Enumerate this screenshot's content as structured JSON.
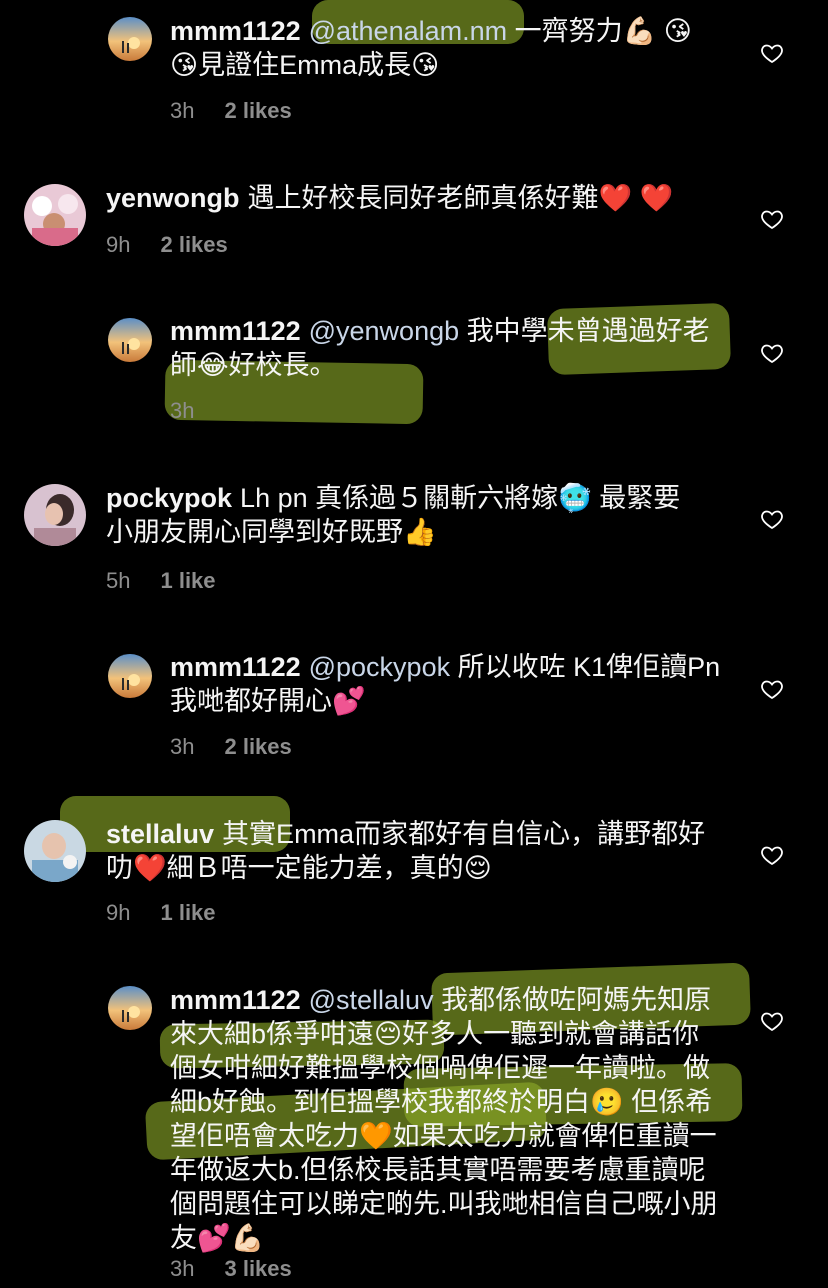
{
  "comments": [
    {
      "user": "mmm1122",
      "mention": "@athenalam.nm",
      "text": "一齊努力💪🏻 😘 😘見證住Emma成長😘",
      "time": "3h",
      "likes": "2 likes"
    },
    {
      "user": "yenwongb",
      "text": "遇上好校長同好老師真係好難❤️ ❤️",
      "time": "9h",
      "likes": "2 likes"
    },
    {
      "user": "mmm1122",
      "mention": "@yenwongb",
      "text": "我中學未曾遇過好老師😂好校長。",
      "time": "3h",
      "likes": ""
    },
    {
      "user": "pockypok",
      "text": "Lh pn 真係過５關斬六將嫁🥶 最緊要小朋友開心同學到好既野👍",
      "time": "5h",
      "likes": "1 like"
    },
    {
      "user": "mmm1122",
      "mention": "@pockypok",
      "text": "所以收咗 K1俾佢讀Pn 我哋都好開心💕",
      "time": "3h",
      "likes": "2 likes"
    },
    {
      "user": "stellaluv",
      "text": "其實Emma而家都好有自信心，講野都好叻❤️細Ｂ唔一定能力差，真的😌",
      "time": "9h",
      "likes": "1 like"
    },
    {
      "user": "mmm1122",
      "mention": "@stellaluv",
      "text": "我都係做咗阿媽先知原來大細b係爭咁遠😔好多人一聽到就會講話你個女咁細好難搵學校個喎俾佢遲一年讀啦。做細b好蝕。到佢搵學校我都終於明白🥲 但係希望佢唔會太吃力🧡如果太吃力就會俾佢重讀一年做返大b.但係校長話其實唔需要考慮重讀呢個問題住可以睇定啲先.叫我哋相信自己嘅小朋友💕💪🏻",
      "time": "3h",
      "likes": "3 likes"
    }
  ],
  "colors": {
    "background": "#000000",
    "text": "#f5f5f5",
    "meta": "#8e8e8e",
    "highlight": "#8caa28"
  },
  "icons": {
    "like": "heart-outline-icon"
  }
}
